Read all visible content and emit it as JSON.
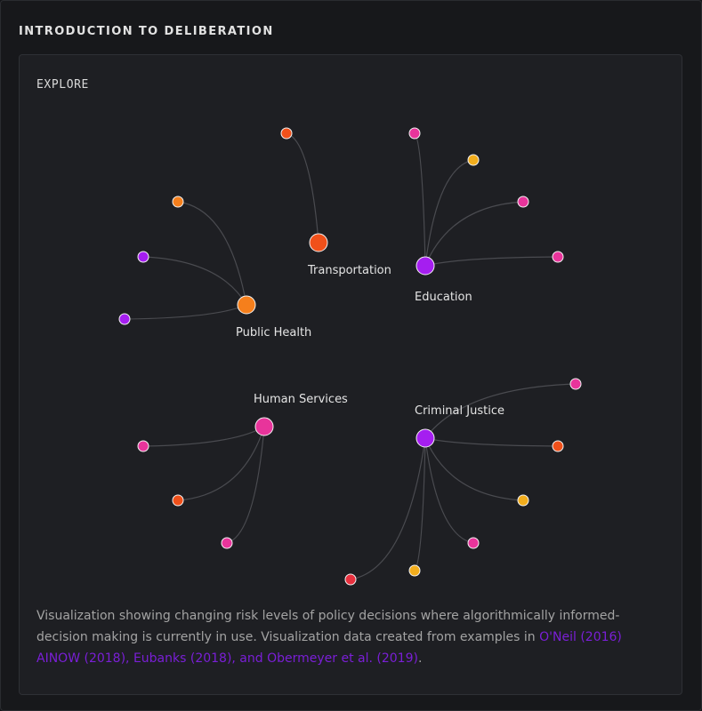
{
  "section_title": "INTRODUCTION TO DELIBERATION",
  "card": {
    "label": "EXPLORE",
    "caption_text": "Visualization showing changing risk levels of policy decisions where algorithmically informed-decision making is currently in use. Visualization data created from examples in ",
    "caption_link": "O'Neil (2016) AINOW (2018), Eubanks (2018), and Obermeyer et al. (2019)",
    "caption_end": "."
  },
  "colors": {
    "pink": "#e8349b",
    "orange_red": "#f0501a",
    "orange": "#f57f1c",
    "yellow": "#f2ad1c",
    "purple": "#a51ef0",
    "red": "#e8303e",
    "edge": "#4a4b50",
    "link": "#7a1fd6"
  },
  "chart_data": {
    "type": "network",
    "hubs": [
      {
        "name": "Transportation",
        "color": "orange_red"
      },
      {
        "name": "Education",
        "color": "purple"
      },
      {
        "name": "Public Health",
        "color": "orange"
      },
      {
        "name": "Human Services",
        "color": "pink"
      },
      {
        "name": "Criminal Justice",
        "color": "purple"
      }
    ],
    "leaves": [
      {
        "hub": "Transportation",
        "color": "orange_red"
      },
      {
        "hub": "Education",
        "color": "pink"
      },
      {
        "hub": "Education",
        "color": "yellow"
      },
      {
        "hub": "Education",
        "color": "pink"
      },
      {
        "hub": "Education",
        "color": "pink"
      },
      {
        "hub": "Public Health",
        "color": "orange"
      },
      {
        "hub": "Public Health",
        "color": "purple"
      },
      {
        "hub": "Public Health",
        "color": "purple"
      },
      {
        "hub": "Human Services",
        "color": "pink"
      },
      {
        "hub": "Human Services",
        "color": "orange_red"
      },
      {
        "hub": "Human Services",
        "color": "pink"
      },
      {
        "hub": "Criminal Justice",
        "color": "pink"
      },
      {
        "hub": "Criminal Justice",
        "color": "orange_red"
      },
      {
        "hub": "Criminal Justice",
        "color": "yellow"
      },
      {
        "hub": "Criminal Justice",
        "color": "pink"
      },
      {
        "hub": "Criminal Justice",
        "color": "yellow"
      },
      {
        "hub": "Criminal Justice",
        "color": "red"
      }
    ]
  }
}
